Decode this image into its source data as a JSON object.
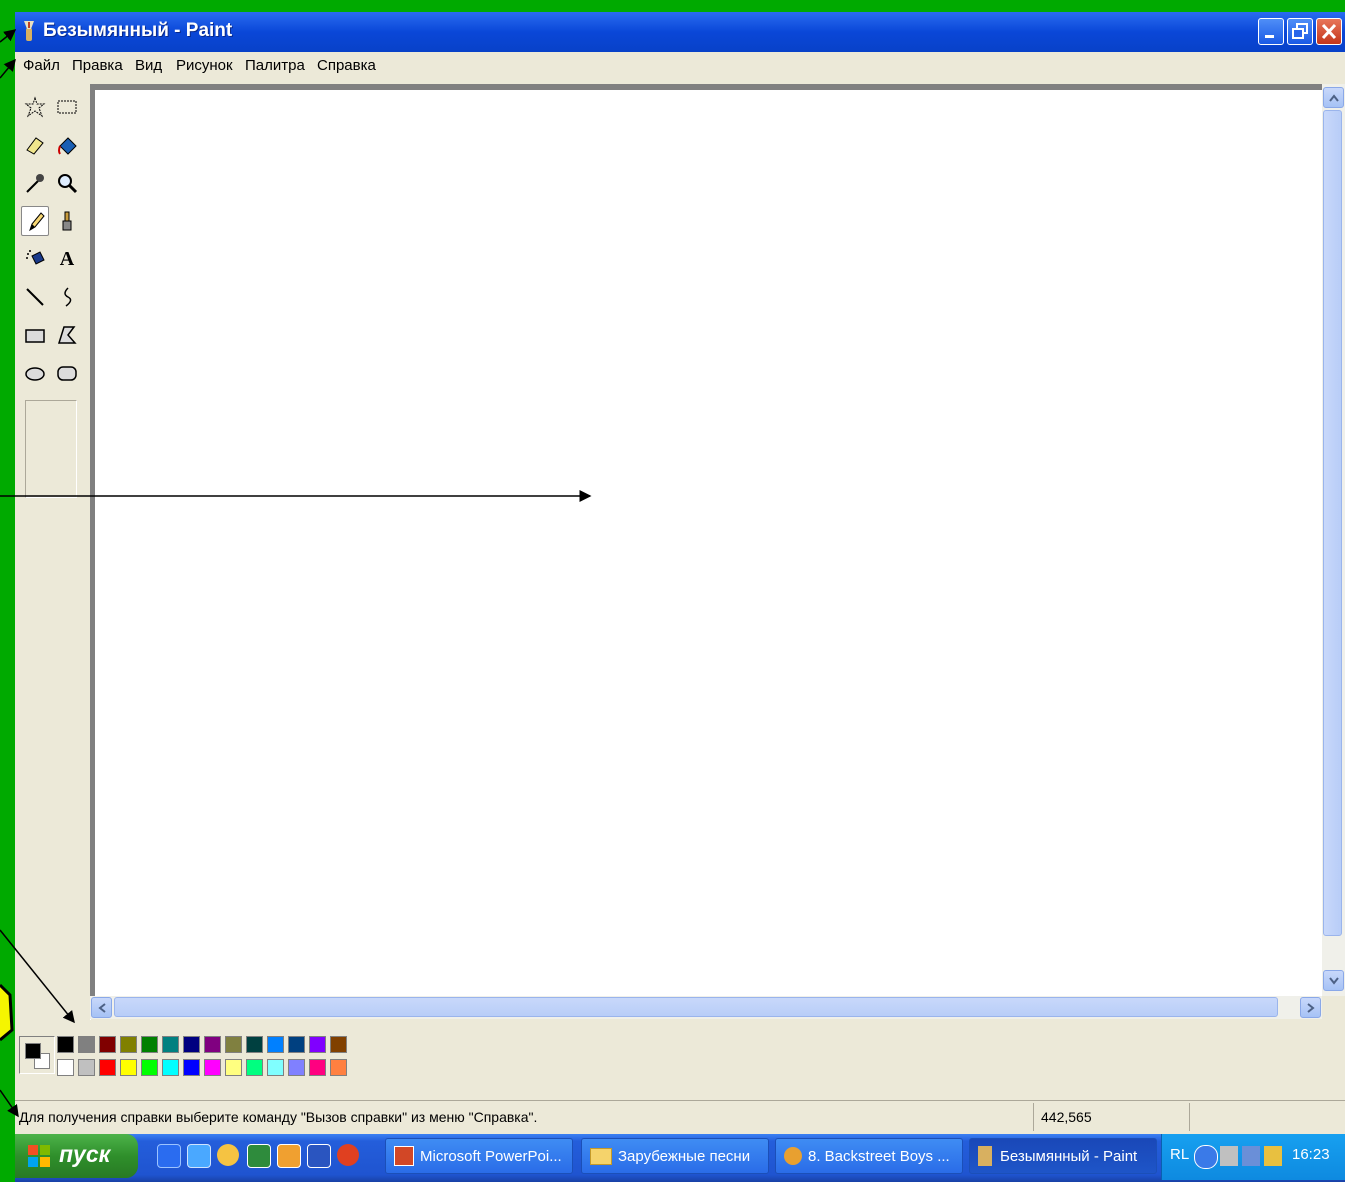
{
  "window": {
    "title": "Безымянный - Paint"
  },
  "menu": [
    "Файл",
    "Правка",
    "Вид",
    "Рисунок",
    "Палитра",
    "Справка"
  ],
  "tools": [
    {
      "name": "free-select-icon"
    },
    {
      "name": "rect-select-icon"
    },
    {
      "name": "eraser-icon"
    },
    {
      "name": "fill-bucket-icon"
    },
    {
      "name": "color-picker-icon"
    },
    {
      "name": "magnifier-icon"
    },
    {
      "name": "pencil-icon",
      "selected": true
    },
    {
      "name": "brush-icon"
    },
    {
      "name": "airbrush-icon"
    },
    {
      "name": "text-icon",
      "glyph": "A"
    },
    {
      "name": "line-icon"
    },
    {
      "name": "curve-icon"
    },
    {
      "name": "rectangle-icon"
    },
    {
      "name": "polygon-icon"
    },
    {
      "name": "ellipse-icon"
    },
    {
      "name": "rounded-rect-icon"
    }
  ],
  "palette": {
    "foreground": "#000000",
    "background": "#ffffff",
    "row1": [
      "#000000",
      "#808080",
      "#800000",
      "#808000",
      "#008000",
      "#008080",
      "#000080",
      "#800080",
      "#808040",
      "#004040",
      "#0080ff",
      "#004080",
      "#8000ff",
      "#804000"
    ],
    "row2": [
      "#ffffff",
      "#c0c0c0",
      "#ff0000",
      "#ffff00",
      "#00ff00",
      "#00ffff",
      "#0000ff",
      "#ff00ff",
      "#ffff80",
      "#00ff80",
      "#80ffff",
      "#8080ff",
      "#ff0080",
      "#ff8040"
    ]
  },
  "status": {
    "help_text": "Для получения справки выберите команду \"Вызов справки\" из меню \"Справка\".",
    "coords": "442,565"
  },
  "taskbar": {
    "start_label": "пуск",
    "tasks": [
      {
        "label": "Microsoft PowerPoi...",
        "icon": "powerpoint-icon"
      },
      {
        "label": "Зарубежные песни",
        "icon": "folder-icon"
      },
      {
        "label": "8. Backstreet Boys ...",
        "icon": "media-icon"
      },
      {
        "label": "Безымянный - Paint",
        "icon": "paint-icon",
        "active": true
      }
    ],
    "lang": "RL",
    "clock": "16:23"
  }
}
